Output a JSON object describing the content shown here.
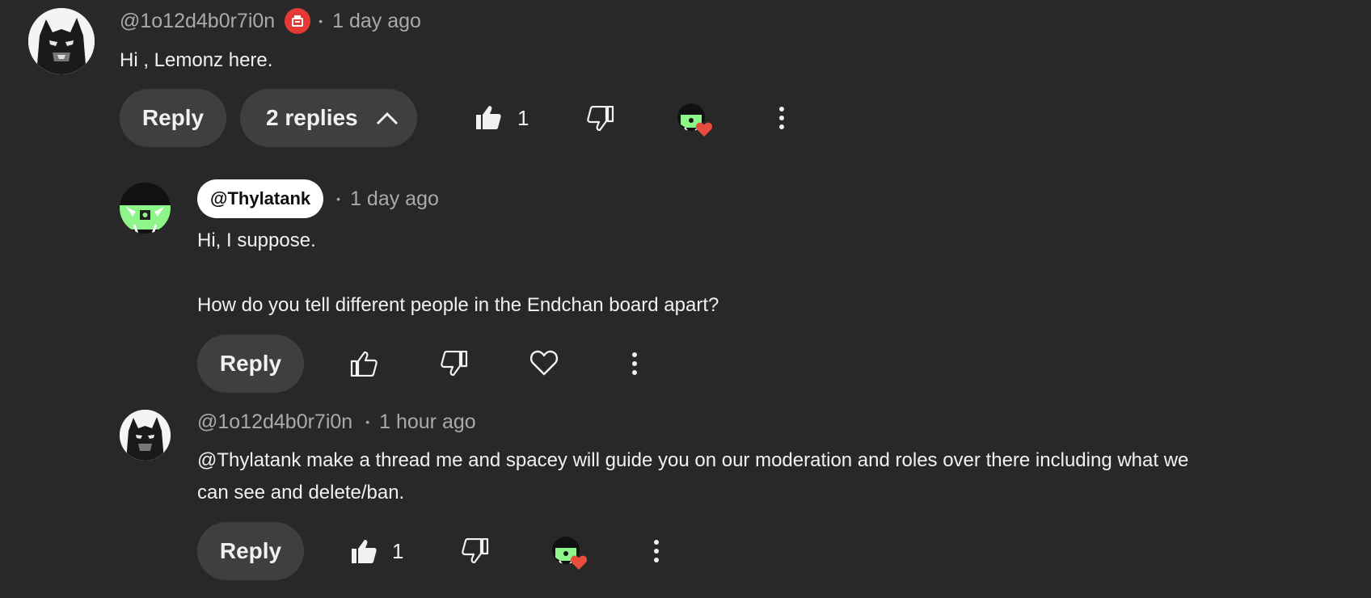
{
  "comment": {
    "author": "@1o12d4b0r7i0n",
    "member_badge": "member-badge-icon",
    "time": "1 day ago",
    "text": "Hi , Lemonz here.",
    "reply_label": "Reply",
    "replies_toggle_label": "2 replies",
    "like_count": "1"
  },
  "replies": [
    {
      "author": "@Thylatank",
      "time": "1 day ago",
      "text_line1": "Hi, I suppose.",
      "text_line2": "How do you tell different people in the Endchan board apart?",
      "reply_label": "Reply"
    },
    {
      "author": "@1o12d4b0r7i0n",
      "time": "1 hour ago",
      "text_line1": "@Thylatank make a thread me and spacey will guide you on our moderation and roles over there including what we",
      "text_line2": "can see and delete/ban.",
      "reply_label": "Reply",
      "like_count": "1"
    }
  ],
  "colors": {
    "background": "#282828",
    "pill": "#3f3f3f",
    "meta_text": "#aaaaaa",
    "heart": "#e74c3c",
    "badge_red": "#e53935",
    "creator_green": "#8ef58a"
  }
}
